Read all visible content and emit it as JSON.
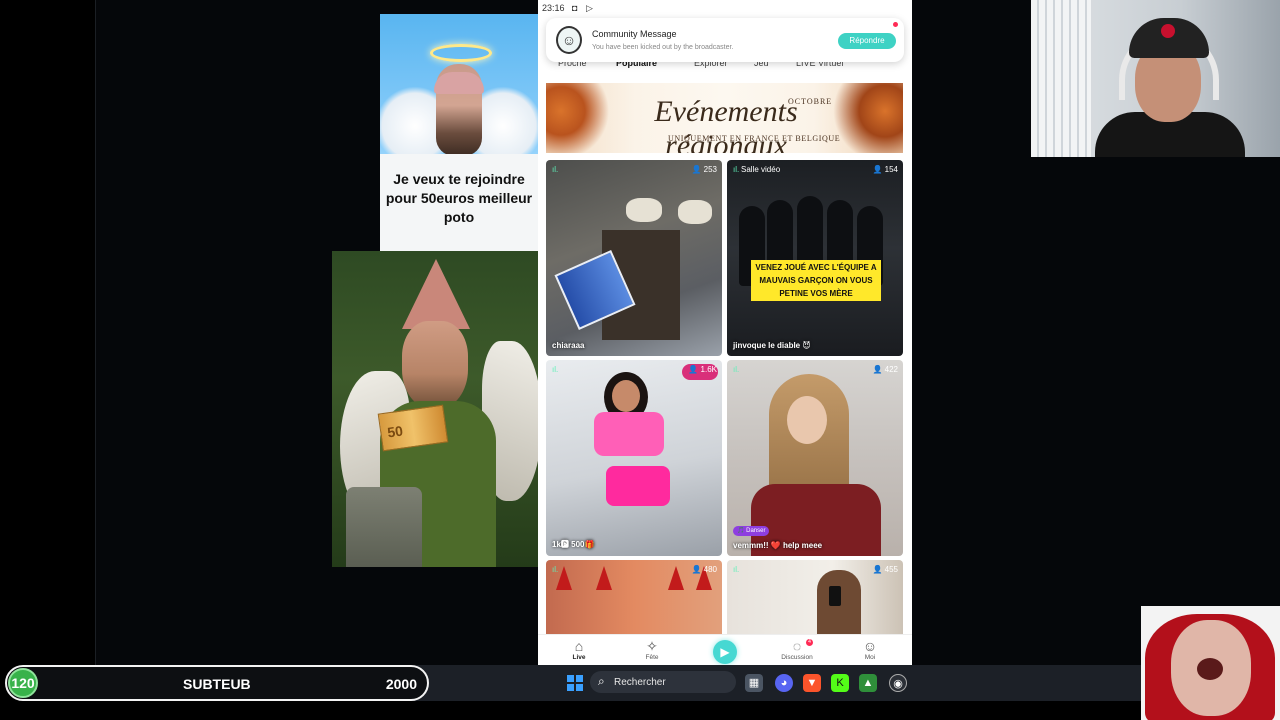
{
  "meme_top": {
    "caption": "Je veux te rejoindre pour 50euros meilleur poto"
  },
  "meme_bottom": {
    "banknote": "50"
  },
  "phone": {
    "status_time": "23:16",
    "notification": {
      "title": "Community Message",
      "message": "You have been kicked out by the broadcaster.",
      "reply_label": "Répondre"
    },
    "tabs": [
      "Proche",
      "Populaire",
      "Explorer",
      "Jeu",
      "LIVE Virtuel"
    ],
    "banner": {
      "month": "OCTOBRE",
      "title": "Evénements régionaux",
      "subtitle": "UNIQUEMENT EN FRANCE ET BELGIQUE"
    },
    "streams": [
      {
        "label": "",
        "viewers": "253",
        "name": "chiaraaa",
        "tag": ""
      },
      {
        "label": "Salle vidéo",
        "viewers": "154",
        "name": "jinvoque le diable 😈",
        "tag": "",
        "overlay_text": "VENEZ JOUÉ AVEC L'ÉQUIPE A MAUVAIS GARÇON ON VOUS PETINE VOS MÈRE"
      },
      {
        "label": "",
        "viewers": "1.6K",
        "name": "1k🅿 500🎁",
        "tag": ""
      },
      {
        "label": "",
        "viewers": "422",
        "name": "vemmm!! ❤️ help meee",
        "tag": "🎵 Danser"
      },
      {
        "label": "",
        "viewers": "480",
        "name": "",
        "tag": ""
      },
      {
        "label": "",
        "viewers": "455",
        "name": "",
        "tag": ""
      }
    ],
    "nav": [
      {
        "label": "Live",
        "icon": "home-icon"
      },
      {
        "label": "Fête",
        "icon": "party-icon"
      },
      {
        "label": "",
        "icon": "camera-icon"
      },
      {
        "label": "Discussion",
        "icon": "chat-icon"
      },
      {
        "label": "Moi",
        "icon": "profile-icon"
      }
    ],
    "discussion_badge": "4"
  },
  "overlay": {
    "level": "120",
    "label": "SUBTEUB",
    "goal": "2000"
  },
  "taskbar": {
    "search_placeholder": "Rechercher"
  },
  "colors": {
    "accent": "#3ed2c4",
    "progress_green": "#38b24a"
  }
}
